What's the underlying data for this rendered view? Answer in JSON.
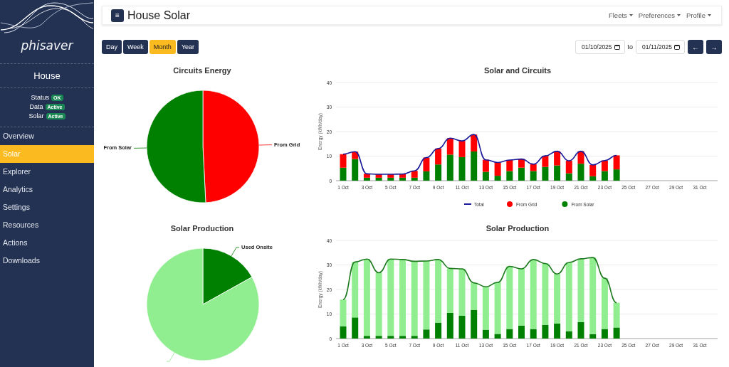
{
  "sidebar": {
    "logo": "phisaver",
    "site": "House",
    "status": [
      {
        "label": "Status",
        "badge": "OK"
      },
      {
        "label": "Data",
        "badge": "Active"
      },
      {
        "label": "Solar",
        "badge": "Active"
      }
    ],
    "items": [
      {
        "label": "Overview",
        "selected": false
      },
      {
        "label": "Solar",
        "selected": true
      },
      {
        "label": "Explorer",
        "selected": false
      },
      {
        "label": "Analytics",
        "selected": false
      },
      {
        "label": "Settings",
        "selected": false
      },
      {
        "label": "Resources",
        "selected": false
      },
      {
        "label": "Actions",
        "selected": false
      },
      {
        "label": "Downloads",
        "selected": false
      }
    ]
  },
  "header": {
    "menu_button": "≡",
    "title": "House Solar",
    "menus": [
      "Fleets",
      "Preferences",
      "Profile"
    ]
  },
  "periods": [
    {
      "label": "Day",
      "selected": false
    },
    {
      "label": "Week",
      "selected": false
    },
    {
      "label": "Month",
      "selected": true
    },
    {
      "label": "Year",
      "selected": false
    }
  ],
  "date_range": {
    "from": "01/10/2025",
    "separator": "to",
    "to": "01/11/2025",
    "prev": "←",
    "next": "→"
  },
  "charts": [
    {
      "chart_data": {
        "type": "pie",
        "title": "Circuits Energy",
        "categories": [
          "From Grid",
          "From Solar"
        ],
        "values": [
          49.2,
          50.8
        ],
        "colors": [
          "#ff0000",
          "#008000"
        ]
      }
    },
    {
      "chart_data": {
        "type": "bar",
        "title": "Solar and Circuits",
        "ylabel": "Energy (kWh/day)",
        "stacked": true,
        "grid": true,
        "legend": "bottom",
        "ylim": [
          0,
          40
        ],
        "yticks": [
          0,
          10,
          20,
          30,
          40
        ],
        "categories": [
          "1 Oct",
          null,
          "3 Oct",
          null,
          "5 Oct",
          null,
          "7 Oct",
          null,
          "9 Oct",
          null,
          "11 Oct",
          null,
          "13 Oct",
          null,
          "15 Oct",
          null,
          "17 Oct",
          null,
          "19 Oct",
          null,
          "21 Oct",
          null,
          "23 Oct",
          null,
          "25 Oct",
          null,
          "27 Oct",
          null,
          "29 Oct",
          null,
          "31 Oct"
        ],
        "series": [
          {
            "name": "Total",
            "type": "line",
            "color": "#1a1a9a",
            "values": [
              10.8,
              11.8,
              2.8,
              2.6,
              2.6,
              2.7,
              4.0,
              9.4,
              13.1,
              17.3,
              16.2,
              18.8,
              8.5,
              7.4,
              8.4,
              8.8,
              6.7,
              10.1,
              12.0,
              8.1,
              12.0,
              6.4,
              8.2,
              10.3,
              null,
              null,
              null,
              null,
              null,
              null,
              null
            ]
          },
          {
            "name": "From Grid",
            "type": "bar",
            "color": "#ff0000",
            "values": [
              5.5,
              3.0,
              1.6,
              1.4,
              1.4,
              1.5,
              2.8,
              5.6,
              6.5,
              6.7,
              6.6,
              6.9,
              4.9,
              5.4,
              4.5,
              3.5,
              2.8,
              4.5,
              5.8,
              5.1,
              5.1,
              4.6,
              4.3,
              5.7,
              null,
              null,
              null,
              null,
              null,
              null,
              null
            ]
          },
          {
            "name": "From Solar",
            "type": "bar",
            "color": "#008000",
            "values": [
              5.3,
              8.8,
              1.2,
              1.2,
              1.2,
              1.2,
              1.2,
              3.8,
              6.6,
              10.6,
              9.6,
              11.9,
              3.6,
              2.0,
              3.9,
              5.3,
              3.9,
              5.6,
              6.2,
              3.0,
              6.9,
              1.8,
              3.9,
              4.6,
              null,
              null,
              null,
              null,
              null,
              null,
              null
            ]
          }
        ]
      }
    },
    {
      "chart_data": {
        "type": "pie",
        "title": "Solar Production",
        "categories": [
          "Used Onsite",
          null
        ],
        "values": [
          16.9,
          83.1
        ],
        "colors": [
          "#008000",
          "#90ee90"
        ]
      }
    },
    {
      "chart_data": {
        "type": "bar",
        "title": "Solar Production",
        "ylabel": "Energy (kWh/day)",
        "stacked": true,
        "grid": true,
        "ylim": [
          0,
          40
        ],
        "yticks": [
          0,
          10,
          20,
          30,
          40
        ],
        "categories": [
          "1 Oct",
          null,
          "3 Oct",
          null,
          "5 Oct",
          null,
          "7 Oct",
          null,
          "9 Oct",
          null,
          "11 Oct",
          null,
          "13 Oct",
          null,
          "15 Oct",
          null,
          "17 Oct",
          null,
          "19 Oct",
          null,
          "21 Oct",
          null,
          "23 Oct",
          null,
          "25 Oct",
          null,
          "27 Oct",
          null,
          "29 Oct",
          null,
          "31 Oct"
        ],
        "series": [
          {
            "type": "line",
            "color": "#1e7a1e",
            "values": [
              15.9,
              31.2,
              32.4,
              26.8,
              32.4,
              32.2,
              31.5,
              31.6,
              32.2,
              28.6,
              28.4,
              22.7,
              21.1,
              22.9,
              29.4,
              28.4,
              32.2,
              30.6,
              26.3,
              31.0,
              32.5,
              33.0,
              24.6,
              14.6,
              null,
              null,
              null,
              null,
              null,
              null,
              null
            ]
          },
          {
            "type": "bar",
            "color": "#90ee90",
            "values": [
              10.9,
              22.6,
              31.3,
              25.7,
              31.3,
              31.1,
              30.4,
              27.9,
              25.7,
              18.1,
              19.1,
              11.0,
              17.5,
              21.0,
              25.5,
              23.1,
              28.3,
              25.0,
              20.2,
              28.0,
              25.8,
              31.2,
              20.7,
              10.1,
              null,
              null,
              null,
              null,
              null,
              null,
              null
            ]
          },
          {
            "type": "bar",
            "color": "#008000",
            "values": [
              5.0,
              8.6,
              1.1,
              1.1,
              1.1,
              1.1,
              1.1,
              3.7,
              6.5,
              10.5,
              9.3,
              11.7,
              3.6,
              1.9,
              3.9,
              5.3,
              3.9,
              5.6,
              6.1,
              3.0,
              6.7,
              1.8,
              3.9,
              4.5,
              null,
              null,
              null,
              null,
              null,
              null,
              null
            ]
          }
        ]
      }
    }
  ]
}
